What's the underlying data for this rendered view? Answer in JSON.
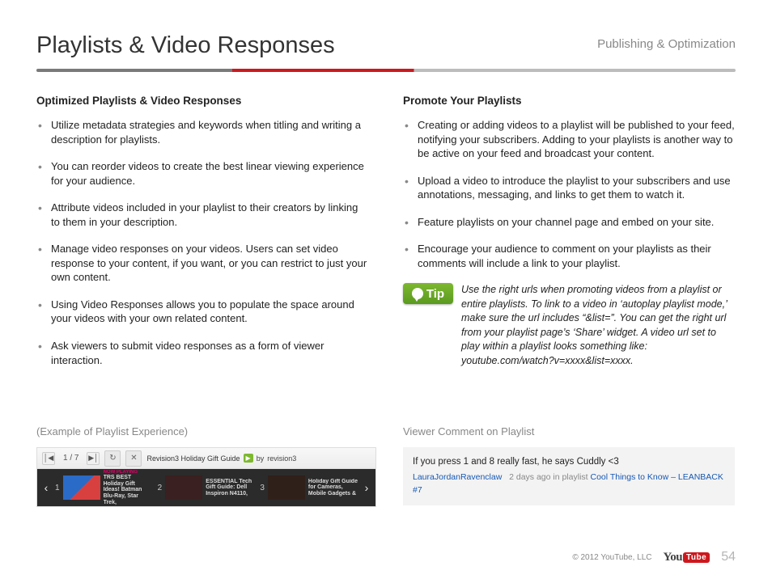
{
  "header": {
    "title": "Playlists & Video Responses",
    "section": "Publishing & Optimization"
  },
  "left": {
    "heading": "Optimized Playlists & Video Responses",
    "bullets": [
      "Utilize metadata strategies and keywords when titling and writing a description for playlists.",
      "You can reorder videos to create the best linear viewing experience for your audience.",
      "Attribute videos included in your playlist to their creators by linking to them in your description.",
      "Manage video responses on your videos. Users can set video response to your content, if you want, or you can restrict to just your own content.",
      "Using Video Responses allows you to populate the space around your videos with your own related content.",
      "Ask viewers to submit video responses as a form of viewer interaction."
    ]
  },
  "right": {
    "heading": "Promote Your Playlists",
    "bullets": [
      "Creating or adding videos to a playlist will be published to your feed, notifying your subscribers. Adding to your playlists is another way to be active on your feed and broadcast your content.",
      "Upload a video to introduce the playlist to your subscribers and use annotations, messaging, and links to get them to watch it.",
      "Feature playlists on your channel page and embed on your site.",
      "Encourage your audience to comment on your playlists as their comments will include a link to your playlist."
    ],
    "tip": {
      "badge": "Tip",
      "text": "Use the right urls when promoting videos from a playlist or entire playlists. To link to a video in ‘autoplay playlist mode,’ make sure the url includes “&list=”. You can get the right url from your playlist page’s ‘Share’ widget. A video url set to play within a playlist looks something like: youtube.com/watch?v=xxxx&list=xxxx."
    }
  },
  "examples": {
    "leftLabel": "(Example of Playlist Experience)",
    "rightLabel": "Viewer Comment on Playlist"
  },
  "playlist": {
    "count": "1 / 7",
    "title": "Revision3 Holiday Gift Guide",
    "byPrefix": "by",
    "byName": "revision3",
    "items": [
      {
        "num": "1",
        "now": "NOW PLAYING",
        "title": "TRS BEST Holiday Gift Ideas! Batman Blu-Ray, Star Trek,",
        "sub": ""
      },
      {
        "num": "2",
        "now": "",
        "title": "ESSENTIAL Tech Gift Guide: Dell Inspiron N4110,",
        "sub": ""
      },
      {
        "num": "3",
        "now": "",
        "title": "Holiday Gift Guide for Cameras, Mobile Gadgets &",
        "sub": ""
      }
    ]
  },
  "comment": {
    "text": "If you press 1 and 8 really fast, he says Cuddly <3",
    "user": "LauraJordanRavenclaw",
    "when": "2 days ago in playlist",
    "playlist": "Cool Things to Know – LEANBACK #7"
  },
  "footer": {
    "copyright": "© 2012 YouTube, LLC",
    "logoYou": "You",
    "logoTube": "Tube",
    "pageNum": "54"
  }
}
